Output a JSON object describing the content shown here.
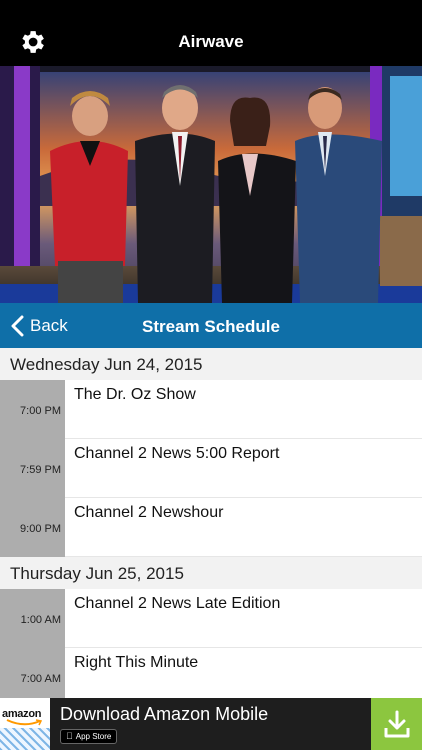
{
  "header": {
    "title": "Airwave",
    "settings_icon": "gear-icon"
  },
  "nav": {
    "back_label": "Back",
    "title": "Stream Schedule"
  },
  "schedule": {
    "days": [
      {
        "label": "Wednesday Jun 24, 2015",
        "items": [
          {
            "time": "7:00 PM",
            "show": "The Dr. Oz Show"
          },
          {
            "time": "7:59 PM",
            "show": "Channel 2 News 5:00 Report"
          },
          {
            "time": "9:00 PM",
            "show": "Channel 2 Newshour"
          }
        ]
      },
      {
        "label": "Thursday Jun 25, 2015",
        "items": [
          {
            "time": "1:00 AM",
            "show": "Channel 2 News Late Edition"
          },
          {
            "time": "7:00 AM",
            "show": "Right This Minute"
          }
        ]
      }
    ]
  },
  "ad": {
    "brand": "amazon",
    "title": "Download Amazon Mobile",
    "badge": "App Store",
    "download_icon": "download-icon"
  },
  "colors": {
    "navbar": "#0f6fa8",
    "header": "#000000",
    "time_cell": "#adadad",
    "download": "#8cc63f"
  }
}
